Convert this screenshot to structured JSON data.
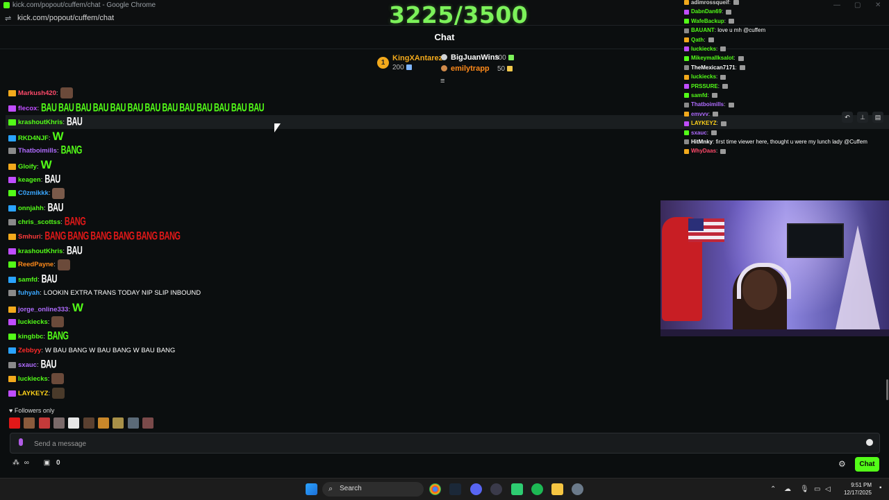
{
  "browser": {
    "window_title": "kick.com/popout/cuffem/chat - Google Chrome",
    "url": "kick.com/popout/cuffem/chat"
  },
  "goal": {
    "text": "3225/3500"
  },
  "chat": {
    "title": "Chat"
  },
  "leaderboard": {
    "first": {
      "rank": "1",
      "name": "KingXAntarez",
      "amount": "200"
    },
    "second": {
      "name": "BigJuanWins",
      "amount": "100"
    },
    "third": {
      "name": "emilytrapp",
      "amount": "50"
    }
  },
  "messages": [
    {
      "user": "Markush420",
      "color": "#ff4a6a",
      "content": ""
    },
    {
      "user": "flecox",
      "color": "#c04dff",
      "content": "BAU BAU BAU BAU BAU BAU BAU BAU BAU BAU BAU BAU BAU",
      "emote_color": "#53fc18"
    },
    {
      "user": "krashoutKhris",
      "color": "#53fc18",
      "content": "BAU",
      "emote_color": "#ffffff"
    },
    {
      "user": "RKD4NJF",
      "color": "#53fc18",
      "content": "W"
    },
    {
      "user": "Thatboimills",
      "color": "#b06cff",
      "content": "BANG",
      "emote_color": "#53fc18"
    },
    {
      "user": "Gloify",
      "color": "#53fc18",
      "content": "W"
    },
    {
      "user": "keagen",
      "color": "#53fc18",
      "content": "BAU",
      "emote_color": "#ffffff"
    },
    {
      "user": "C0zmikkk",
      "color": "#3aa7ff",
      "content": ""
    },
    {
      "user": "onnjahh",
      "color": "#53fc18",
      "content": "BAU",
      "emote_color": "#ffffff"
    },
    {
      "user": "chris_scottss",
      "color": "#53fc18",
      "content": "BANG",
      "emote_color": "#e01818"
    },
    {
      "user": "Smhuri",
      "color": "#ff3a3a",
      "content": "BANG BANG BANG BANG BANG BANG",
      "emote_color": "#e01818"
    },
    {
      "user": "krashoutKhris",
      "color": "#53fc18",
      "content": "BAU",
      "emote_color": "#ffffff"
    },
    {
      "user": "ReedPayne",
      "color": "#ff8a1a",
      "content": ""
    },
    {
      "user": "samfd",
      "color": "#53fc18",
      "content": "BAU",
      "emote_color": "#ffffff"
    },
    {
      "user": "fuhyah",
      "color": "#3aa7ff",
      "content": "LOOKIN EXTRA TRANS TODAY NIP SLIP INBOUND"
    },
    {
      "user": "jorge_online333",
      "color": "#b06cff",
      "content": "W"
    },
    {
      "user": "luckiecks",
      "color": "#53fc18",
      "content": ""
    },
    {
      "user": "kingbbc",
      "color": "#53fc18",
      "content": "BANG",
      "emote_color": "#53fc18"
    },
    {
      "user": "Zebbyy",
      "color": "#ff2a2a",
      "content": "W BAU BANG W BAU BANG W BAU BANG"
    },
    {
      "user": "sxauc",
      "color": "#b06cff",
      "content": "BAU",
      "emote_color": "#ffffff"
    },
    {
      "user": "luckiecks",
      "color": "#53fc18",
      "content": ""
    },
    {
      "user": "LAYKEYZ",
      "color": "#ffd21a",
      "content": ""
    }
  ],
  "followers_only": "Followers only",
  "input": {
    "placeholder": "Send a message"
  },
  "bottom": {
    "count": "0",
    "chat_button": "Chat"
  },
  "overlay_chat": [
    {
      "user": "adimrossqueif",
      "color": "#cfcfcf",
      "text": ""
    },
    {
      "user": "DabnDan69",
      "color": "#53fc18",
      "text": ""
    },
    {
      "user": "WafeBackup",
      "color": "#53fc18",
      "text": ""
    },
    {
      "user": "BAUANT",
      "color": "#53fc18",
      "text": "love u mh @cuffem"
    },
    {
      "user": "Qath",
      "color": "#53fc18",
      "text": ""
    },
    {
      "user": "luckiecks",
      "color": "#53fc18",
      "text": ""
    },
    {
      "user": "Mikeymallksalot",
      "color": "#53fc18",
      "text": ""
    },
    {
      "user": "TheMexican7171",
      "color": "#ffffff",
      "text": ""
    },
    {
      "user": "luckiecks",
      "color": "#53fc18",
      "text": ""
    },
    {
      "user": "PRSSURE",
      "color": "#53fc18",
      "text": ""
    },
    {
      "user": "samfd",
      "color": "#53fc18",
      "text": ""
    },
    {
      "user": "Thatboimills",
      "color": "#b06cff",
      "text": ""
    },
    {
      "user": "emvvv",
      "color": "#b06cff",
      "text": ""
    },
    {
      "user": "LAYKEYZ",
      "color": "#ffd21a",
      "text": ""
    },
    {
      "user": "sxauc",
      "color": "#b06cff",
      "text": ""
    },
    {
      "user": "HitMnky",
      "color": "#ffffff",
      "text": "first time viewer here, thought u were my lunch lady @Cuffem"
    },
    {
      "user": "WhyDaas",
      "color": "#ff4a6a",
      "text": ""
    }
  ],
  "taskbar": {
    "search_label": "Search",
    "time": "9:51 PM",
    "date": "12/17/2025"
  },
  "colors": {
    "accent": "#53fc18",
    "background": "#0b0e0f"
  }
}
